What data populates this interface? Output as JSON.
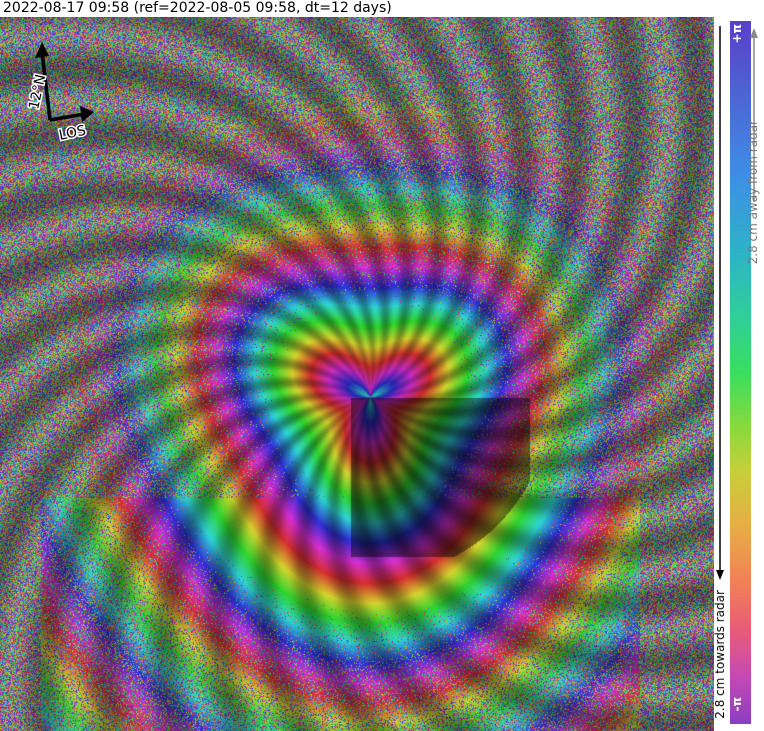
{
  "header": {
    "title": "2022-08-17 09:58 (ref=2022-08-05 09:58, dt=12 days)"
  },
  "compass": {
    "heading_label": "12°N",
    "los_label": "LOS"
  },
  "colorbar": {
    "top_label": "+π",
    "bottom_label": "-π",
    "away_label": "2.8 cm away from radar",
    "towards_label": "2.8 cm towards radar"
  },
  "colors": {
    "bar_top": "#5a3fc8",
    "bar_bottom": "#8a3ec2",
    "away_arrow": "#888888",
    "towards_arrow": "#000000"
  },
  "icons": {
    "compass": "compass-arrows-icon"
  }
}
